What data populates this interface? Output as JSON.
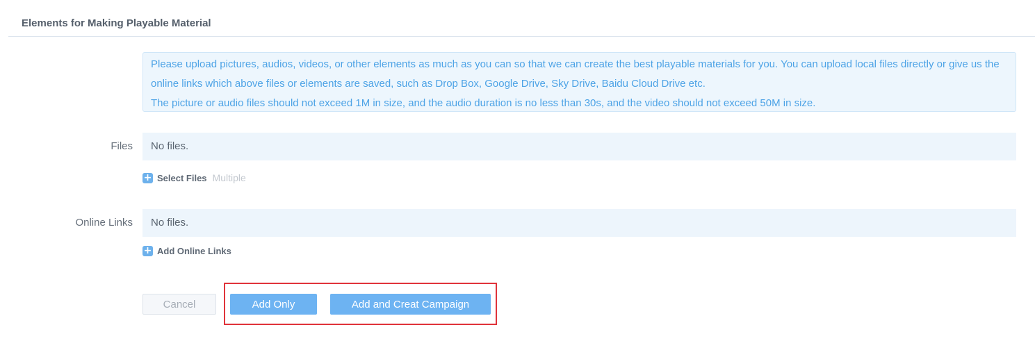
{
  "section": {
    "title": "Elements for Making Playable Material"
  },
  "notice": {
    "line1": "Please upload pictures, audios, videos, or other elements as much as you can so that we can create the best playable materials for you. You can upload local files directly or give us the online links which above files or elements are saved, such as Drop Box, Google Drive, Sky Drive, Baidu Cloud Drive etc.",
    "line2": "The picture or audio files should not exceed 1M in size, and the audio duration is no less than 30s, and the video should not exceed 50M in size."
  },
  "files": {
    "label": "Files",
    "empty_text": "No files.",
    "add_label": "Select Files",
    "hint": "Multiple"
  },
  "online_links": {
    "label": "Online Links",
    "empty_text": "No files.",
    "add_label": "Add Online Links"
  },
  "actions": {
    "cancel_label": "Cancel",
    "add_only_label": "Add Only",
    "add_campaign_label": "Add and Creat Campaign"
  },
  "colors": {
    "primary": "#6db3f2",
    "notice_text": "#4da3e6",
    "notice_bg": "#edf6fd",
    "highlight": "#e0333a"
  },
  "icons": {
    "add": "plus-icon"
  }
}
